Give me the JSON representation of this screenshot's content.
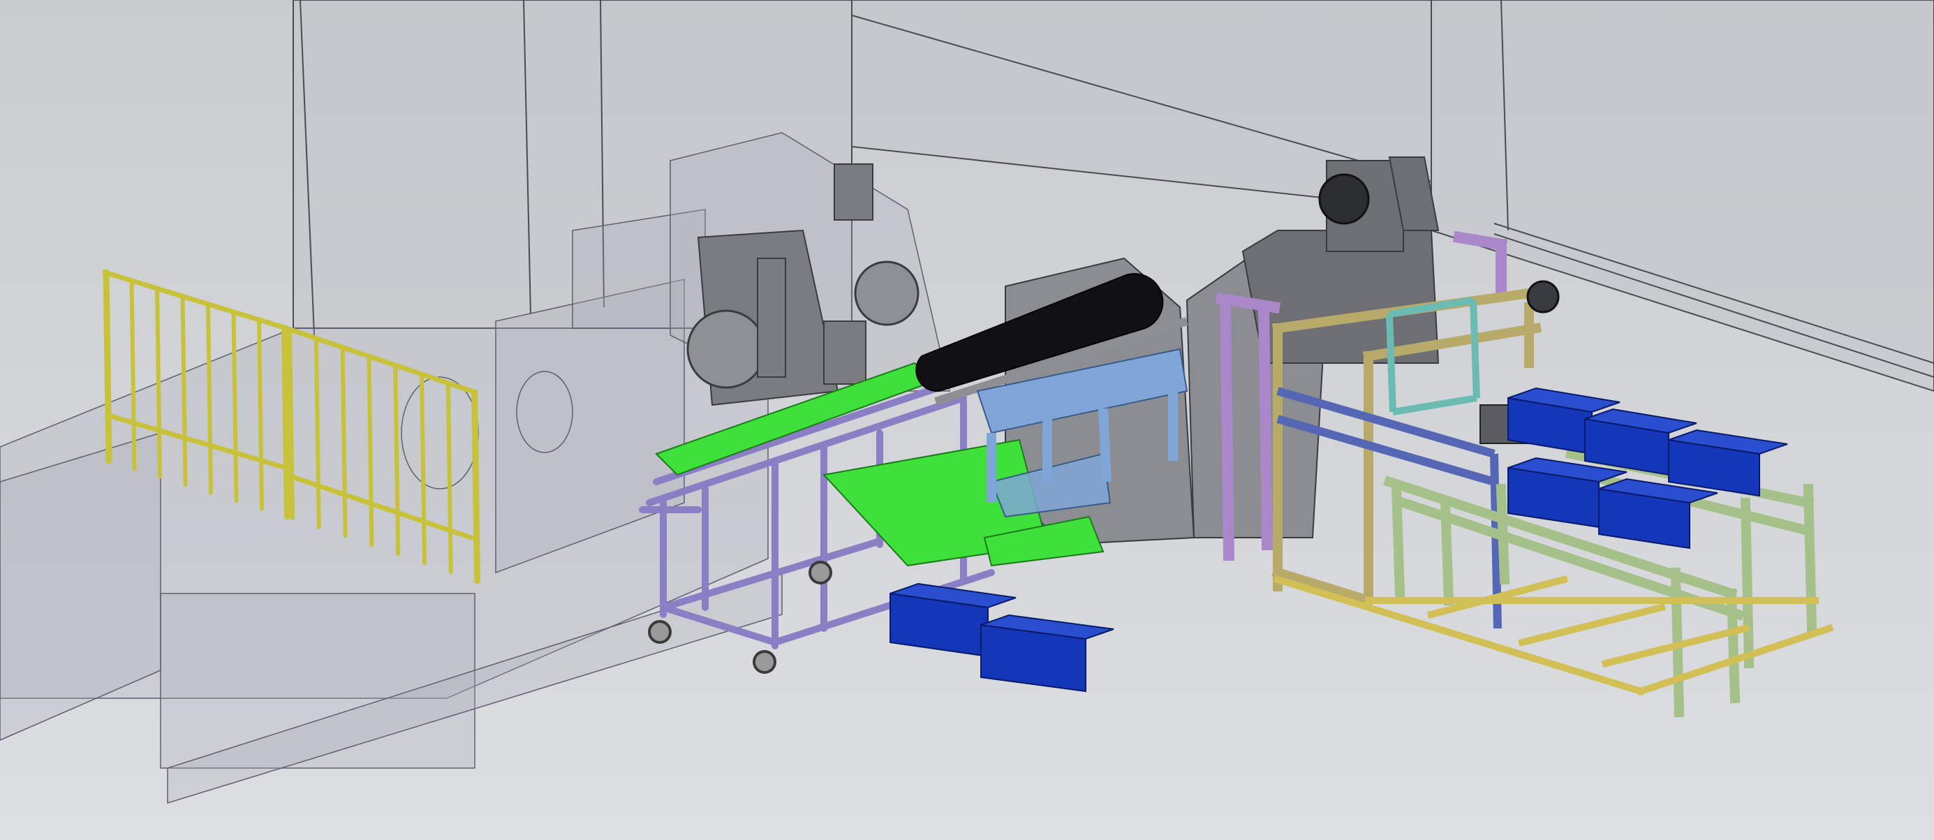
{
  "viewport": {
    "background_top": "#c9cbcf",
    "background_bottom": "#dcdee2"
  },
  "colors": {
    "enclosure_fill": "#a9adb8",
    "enclosure_edge": "#5c6070",
    "wall_fill": "#c3c5ca",
    "wall_edge": "#4a4c55",
    "railing": "#c8c23a",
    "railing_edge": "#6e6a10",
    "cart_frame": "#8a7fc4",
    "cart_edge": "#3f3870",
    "conveyor_green": "#3ee03a",
    "roller_black": "#111114",
    "machine_gray": "#7a7c82",
    "machine_dark": "#3a3b40",
    "light_blue_frame": "#7fa6d6",
    "khaki_frame": "#b8ab6a",
    "lilac_pillar": "#a987c9",
    "teal_frame": "#6bbbb3",
    "green_conveyor_frame": "#a6c08a",
    "crate_blue": "#1436b8",
    "crate_edge": "#0a1a6a",
    "floor_rail": "#d2c056"
  },
  "components": [
    {
      "name": "back-wall",
      "label": ""
    },
    {
      "name": "transparent-enclosure",
      "label": ""
    },
    {
      "name": "safety-railing",
      "label": ""
    },
    {
      "name": "lathe-machine",
      "label": ""
    },
    {
      "name": "loading-cart",
      "label": ""
    },
    {
      "name": "black-roller",
      "label": ""
    },
    {
      "name": "green-conveyor-belt",
      "label": ""
    },
    {
      "name": "blue-frame",
      "label": ""
    },
    {
      "name": "motor-tower",
      "label": ""
    },
    {
      "name": "gantry-frame",
      "label": ""
    },
    {
      "name": "roller-conveyor-racks",
      "label": ""
    },
    {
      "name": "blue-crates",
      "label": ""
    }
  ]
}
